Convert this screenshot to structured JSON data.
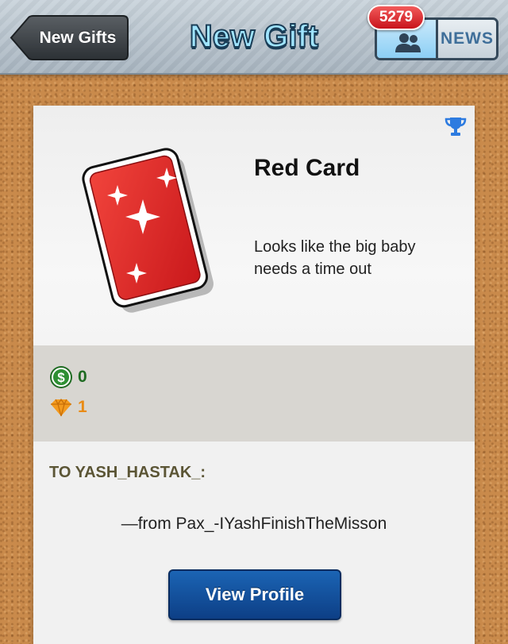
{
  "nav": {
    "back_label": "New Gifts",
    "title": "New Gift",
    "friends_badge_count": "5279",
    "news_label": "NEWS"
  },
  "gift": {
    "name": "Red Card",
    "description": "Looks like the big baby needs a time out",
    "coins": "0",
    "gems": "1"
  },
  "message": {
    "to": "TO YASH_HASTAK_:",
    "from": "—from Pax_-IYashFinishTheMisson"
  },
  "actions": {
    "view_profile_label": "View Profile"
  },
  "colors": {
    "title_fill": "#9fe4ff",
    "badge": "#d81e25",
    "button": "#1b64b4",
    "coins": "#1f6b22",
    "gems": "#e98b14"
  }
}
